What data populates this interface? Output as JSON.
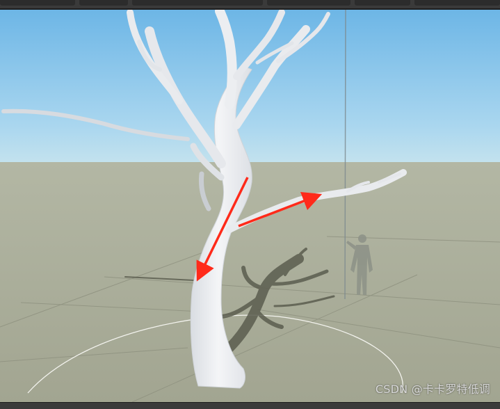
{
  "watermark": {
    "text": "CSDN @卡卡罗特低调"
  },
  "colors": {
    "sky_top": "#74bde8",
    "sky_bottom": "#bfe0ef",
    "ground": "#a8ab96",
    "tree": "#eef0f3",
    "arrow": "#ff2a1a",
    "shadow": "#5b5d4f"
  },
  "icons": {
    "arrow_down": "arrow-down-left",
    "arrow_up": "arrow-up-right"
  }
}
